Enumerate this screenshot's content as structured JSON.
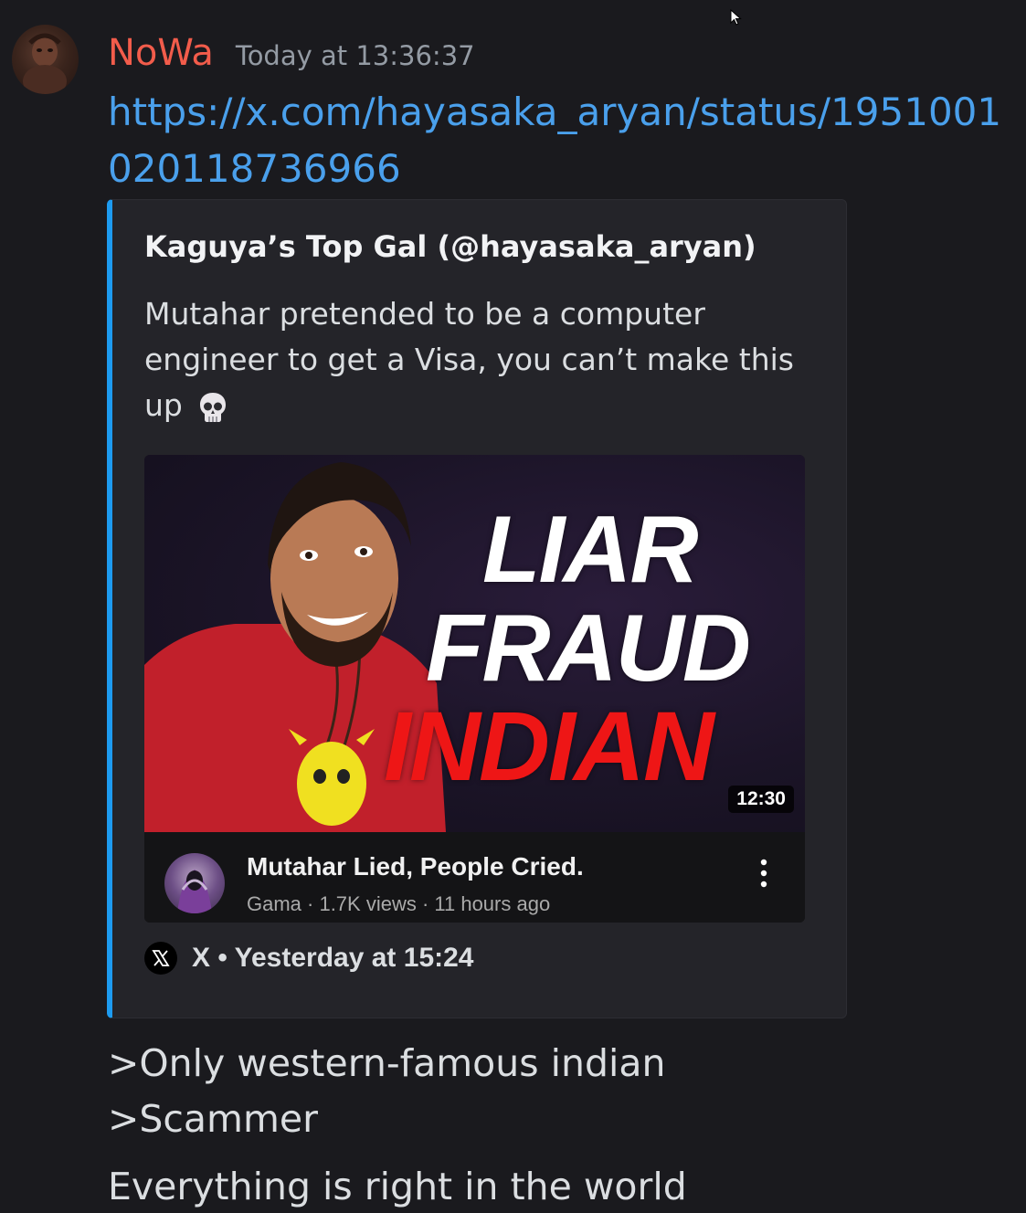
{
  "message": {
    "username": "NoWa",
    "timestamp": "Today at  13:36:37",
    "link": "https://x.com/hayasaka_aryan/status/1951001020118736966",
    "lines": [
      ">Only western-famous indian",
      ">Scammer",
      "Everything is right in the world"
    ],
    "username_color": "#f25c4b",
    "link_color": "#4aa0ec"
  },
  "embed": {
    "author": "Kaguya’s Top Gal (@hayasaka_aryan)",
    "description": "Mutahar pretended to be a computer engineer to get a Visa, you can’t make this up",
    "description_emoji": "skull-icon",
    "accent_color": "#1d9bf0",
    "footer": "X • Yesterday at 15:24",
    "video": {
      "thumbnail_text": [
        "LIAR",
        "FRAUD",
        "INDIAN"
      ],
      "duration": "12:30",
      "title": "Mutahar Lied, People Cried.",
      "meta": "Gama · 1.7K views · 11 hours ago"
    }
  }
}
